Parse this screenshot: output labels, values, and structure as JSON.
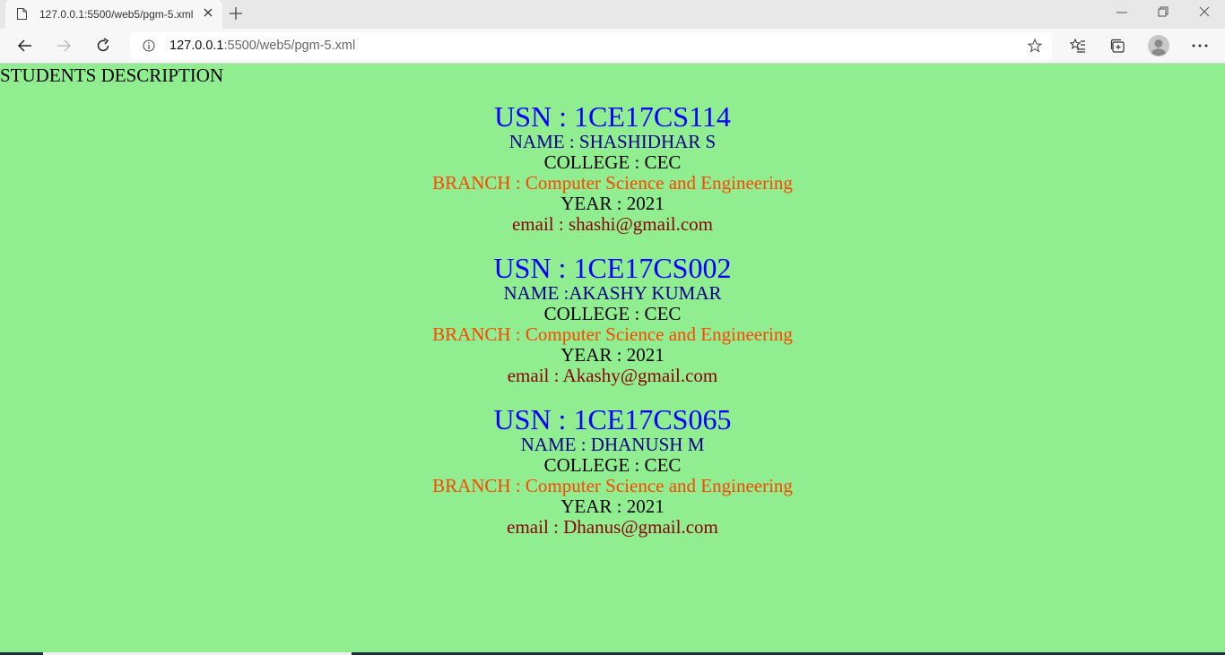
{
  "browser": {
    "tab_title": "127.0.0.1:5500/web5/pgm-5.xml",
    "url_host": "127.0.0.1",
    "url_path": ":5500/web5/pgm-5.xml",
    "icons": [
      "page-icon",
      "close-icon",
      "plus-icon",
      "minimize-icon",
      "restore-icon",
      "close-window-icon",
      "back-arrow-icon",
      "forward-arrow-icon",
      "reload-icon",
      "info-icon",
      "star-icon",
      "favorites-icon",
      "collections-icon",
      "profile-avatar",
      "more-icon"
    ]
  },
  "page": {
    "heading": "STUDENTS DESCRIPTION",
    "background": "#90ee90",
    "students": [
      {
        "usn": "USN : 1CE17CS114",
        "name": "NAME : SHASHIDHAR S",
        "college": "COLLEGE : CEC",
        "branch": "BRANCH : Computer Science and Engineering",
        "year": "YEAR : 2021",
        "email": "email : shashi@gmail.com"
      },
      {
        "usn": "USN : 1CE17CS002",
        "name": "NAME :AKASHY KUMAR",
        "college": "COLLEGE : CEC",
        "branch": "BRANCH : Computer Science and Engineering",
        "year": "YEAR : 2021",
        "email": "email : Akashy@gmail.com"
      },
      {
        "usn": "USN : 1CE17CS065",
        "name": "NAME : DHANUSH M",
        "college": "COLLEGE : CEC",
        "branch": "BRANCH : Computer Science and Engineering",
        "year": "YEAR : 2021",
        "email": "email : Dhanus@gmail.com"
      }
    ]
  }
}
